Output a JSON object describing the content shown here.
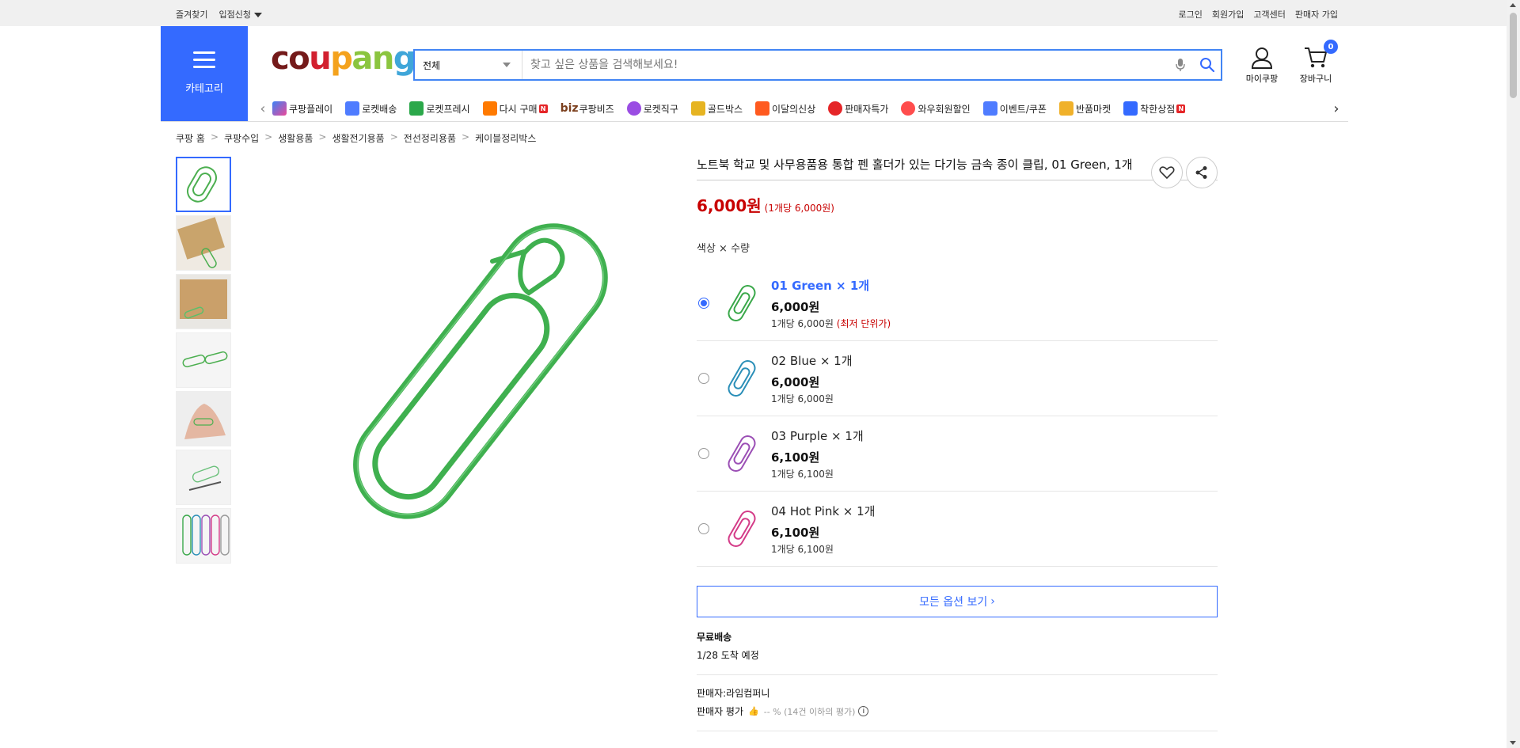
{
  "topbar": {
    "left": [
      "즐겨찾기",
      "입점신청"
    ],
    "right": [
      "로그인",
      "회원가입",
      "고객센터",
      "판매자 가입"
    ]
  },
  "header": {
    "category_label": "카테고리",
    "logo": "coupang",
    "search_scope": "전체",
    "search_placeholder": "찾고 싶은 상품을 검색해보세요!",
    "mycoupang": "마이쿠팡",
    "cart": "장바구니",
    "cart_count": "0"
  },
  "strip": [
    "쿠팡플레이",
    "로켓배송",
    "로켓프레시",
    "다시 구매",
    "쿠팡비즈",
    "로켓직구",
    "골드박스",
    "이달의신상",
    "판매자특가",
    "와우회원할인",
    "이벤트/쿠폰",
    "반품마켓",
    "착한상점"
  ],
  "strip_biz_prefix": "biz",
  "breadcrumb": [
    "쿠팡 홈",
    "쿠팡수입",
    "생활용품",
    "생활전기용품",
    "전선정리용품",
    "케이블정리박스"
  ],
  "product": {
    "title": "노트북 학교 및 사무용품용 통합 펜 홀더가 있는 다기능 금속 종이 클립, 01 Green, 1개",
    "price": "6,000원",
    "unit_price": "(1개당 6,000원)",
    "option_label": "색상 × 수량"
  },
  "options": [
    {
      "name": "01 Green × 1개",
      "price": "6,000원",
      "unit": "1개당 6,000원",
      "low": "(최저 단위가)",
      "color": "#3aa84a"
    },
    {
      "name": "02 Blue × 1개",
      "price": "6,000원",
      "unit": "1개당 6,000원",
      "low": "",
      "color": "#2b8fb8"
    },
    {
      "name": "03 Purple × 1개",
      "price": "6,100원",
      "unit": "1개당 6,100원",
      "low": "",
      "color": "#9b4fb5"
    },
    {
      "name": "04 Hot Pink × 1개",
      "price": "6,100원",
      "unit": "1개당 6,100원",
      "low": "",
      "color": "#d43c88"
    }
  ],
  "all_options": "모든 옵션 보기",
  "shipping": {
    "free": "무료배송",
    "eta": "1/28 도착 예정"
  },
  "seller": {
    "name": "판매자:라임컴퍼니",
    "rating_label": "판매자 평가",
    "rating_text": "-- % (14건 이하의 평가)"
  },
  "colors": {
    "accent": "#346aff",
    "price": "#c80000"
  }
}
